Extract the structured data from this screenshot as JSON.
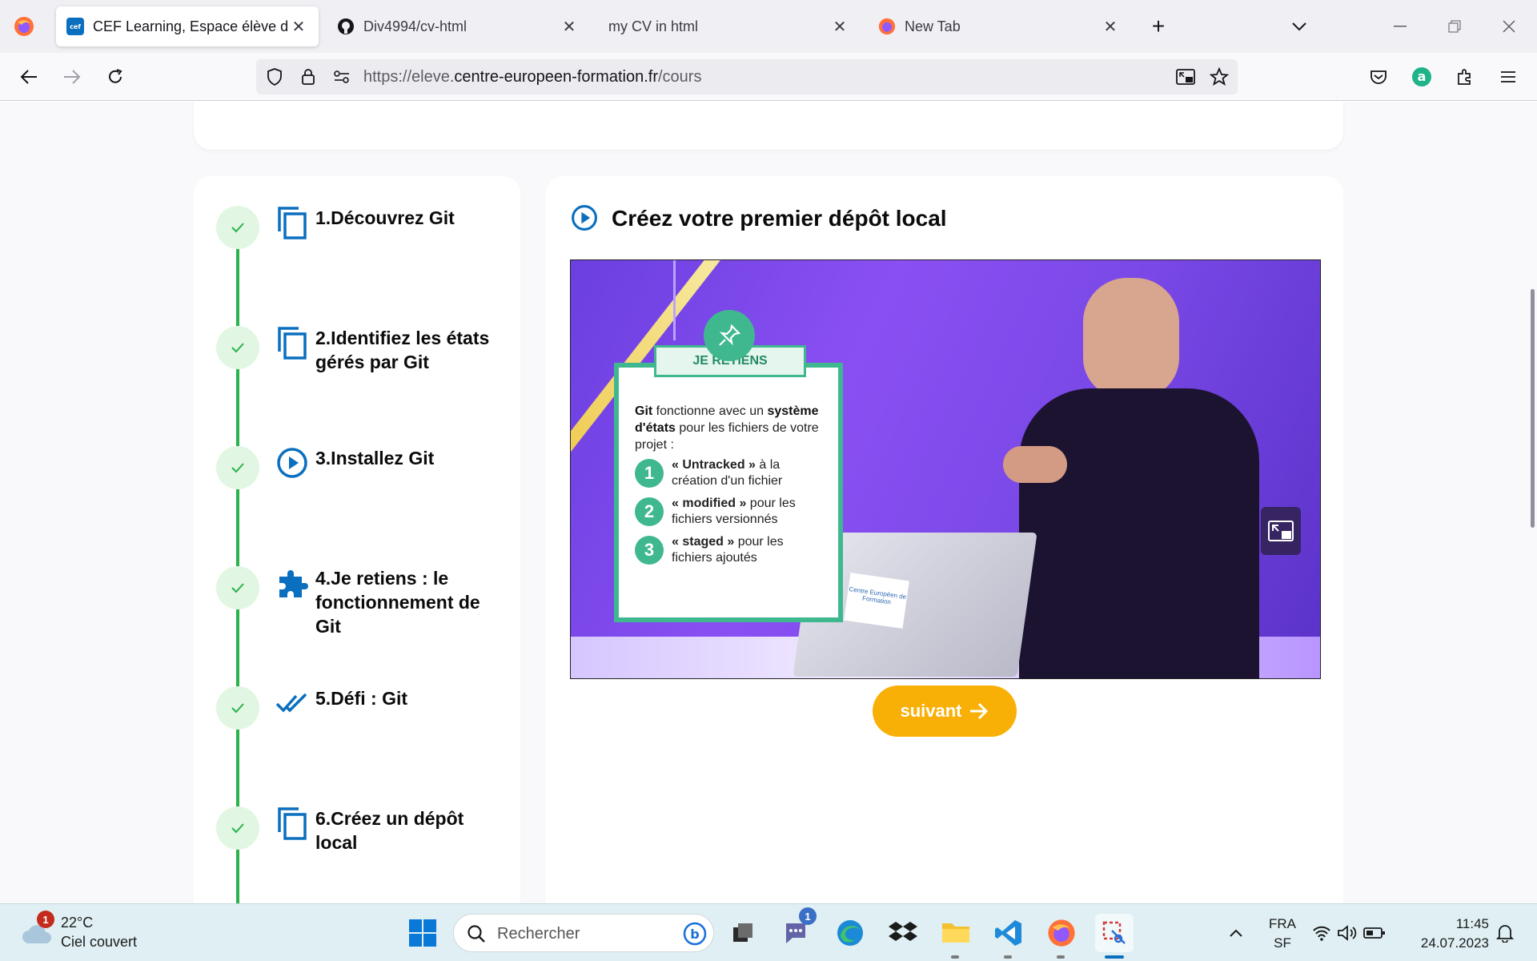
{
  "browser": {
    "tabs": [
      {
        "title": "CEF Learning, Espace élève du C",
        "active": true
      },
      {
        "title": "Div4994/cv-html",
        "active": false
      },
      {
        "title": "my CV in html",
        "active": false
      },
      {
        "title": "New Tab",
        "active": false
      }
    ],
    "url_prefix": "https://eleve.",
    "url_domain": "centre-europeen-formation.fr",
    "url_path": "/cours"
  },
  "course": {
    "steps": [
      {
        "label": "1.Découvrez Git",
        "icon": "copy-icon"
      },
      {
        "label": "2.Identifiez les états gérés par Git",
        "icon": "copy-icon"
      },
      {
        "label": "3.Installez Git",
        "icon": "play-circle-icon"
      },
      {
        "label": "4.Je retiens : le fonctionnement de Git",
        "icon": "puzzle-icon"
      },
      {
        "label": "5.Défi : Git",
        "icon": "double-check-icon"
      },
      {
        "label": "6.Créez un dépôt local",
        "icon": "copy-icon"
      }
    ],
    "lesson_title": "Créez votre premier dépôt local",
    "next_label": "suivant"
  },
  "video_card": {
    "banner": "JE RETIENS",
    "intro_1": "Git",
    "intro_2": " fonctionne avec un ",
    "intro_3": "système d'états",
    "intro_4": " pour les fichiers de votre projet :",
    "items": [
      {
        "num": "1",
        "bold": "« Untracked »",
        "rest": " à la création d'un fichier"
      },
      {
        "num": "2",
        "bold": "« modified »",
        "rest": " pour les fichiers versionnés"
      },
      {
        "num": "3",
        "bold": "« staged »",
        "rest": " pour les fichiers ajoutés"
      }
    ],
    "laptop_sticker": "Centre Européen de Formation"
  },
  "taskbar": {
    "weather_temp": "22°C",
    "weather_desc": "Ciel couvert",
    "weather_badge": "1",
    "search_placeholder": "Rechercher",
    "teams_badge": "1",
    "lang_1": "FRA",
    "lang_2": "SF",
    "time": "11:45",
    "date": "24.07.2023"
  },
  "colors": {
    "accent_green": "#2bb24c",
    "accent_blue": "#0a6fbf",
    "button_yellow": "#f9b006",
    "card_green": "#3fb88f"
  }
}
